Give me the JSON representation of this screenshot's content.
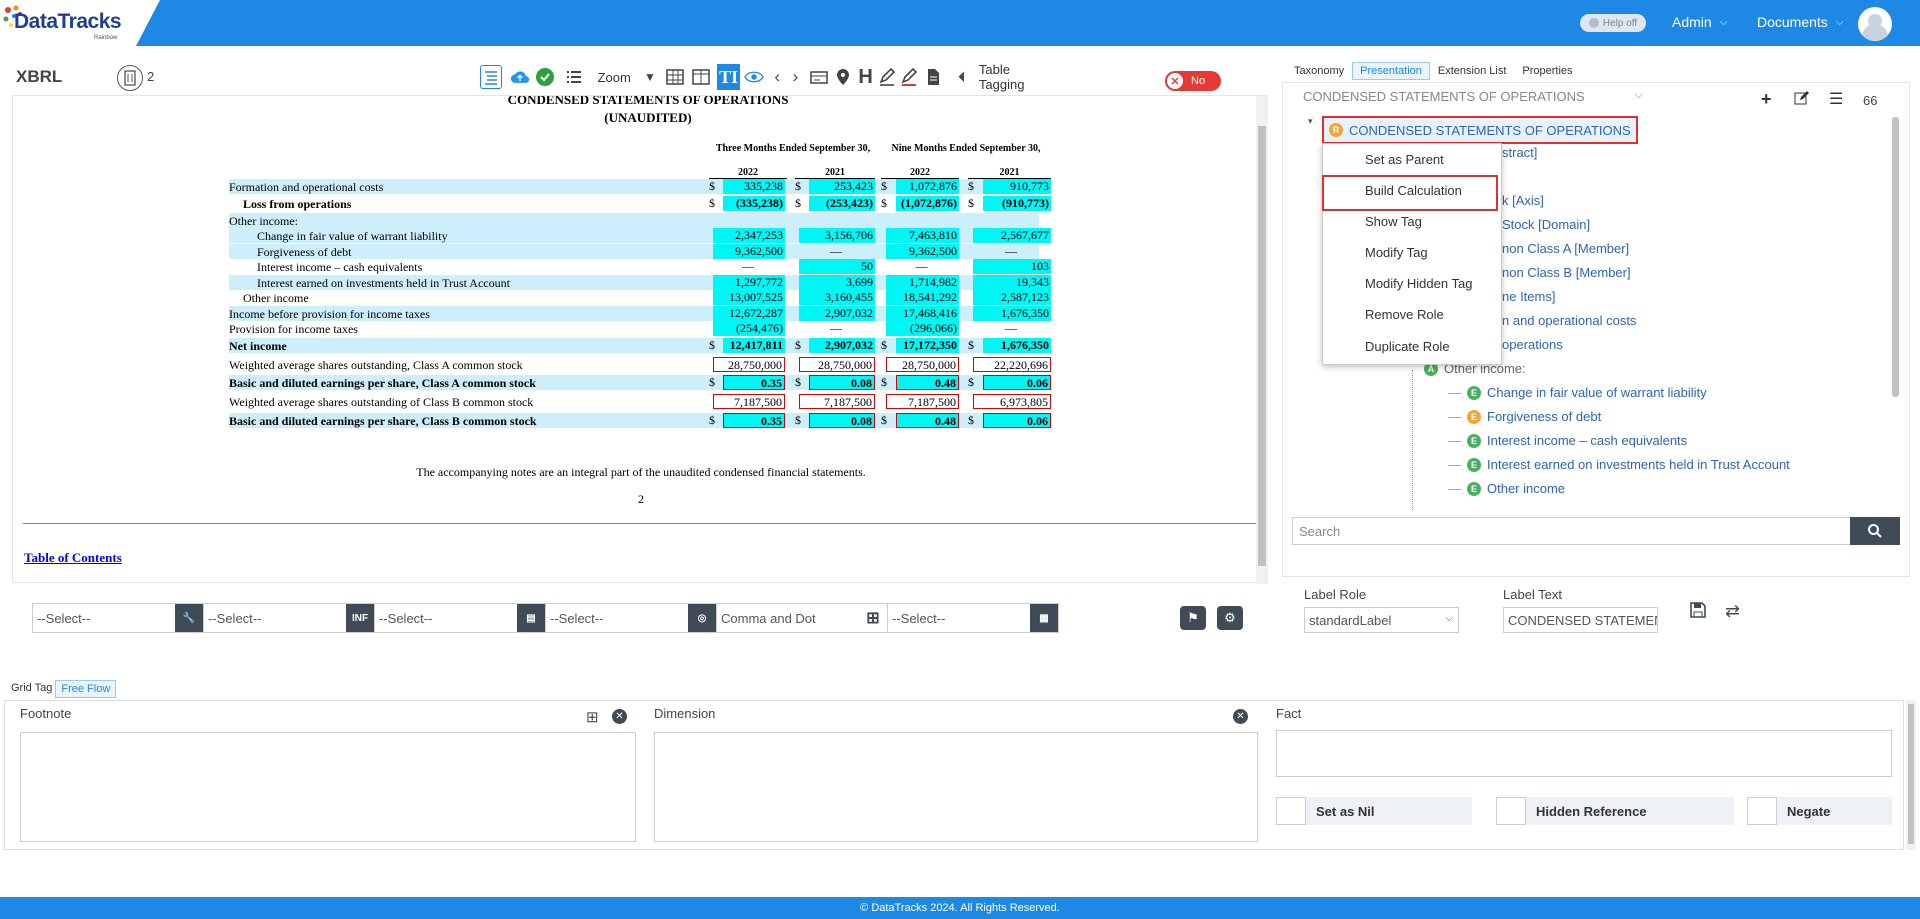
{
  "header": {
    "logo_text": "DataTracks",
    "logo_sub": "Rainbow",
    "help_toggle": "Help off",
    "admin_menu": "Admin",
    "documents_menu": "Documents"
  },
  "toolbar": {
    "app_label": "XBRL",
    "page_count": "2",
    "zoom_label": "Zoom",
    "table_tagging_label": "Table Tagging",
    "table_tagging_toggle": "No"
  },
  "document": {
    "title": "CONDENSED STATEMENTS OF OPERATIONS",
    "subtitle": "(UNAUDITED)",
    "col_groups": [
      "Three Months Ended September 30,",
      "Nine Months Ended September 30,"
    ],
    "years": [
      "2022",
      "2021",
      "2022",
      "2021"
    ],
    "rows": [
      {
        "label": "Formation and operational costs",
        "values": [
          "335,238",
          "253,423",
          "1,072,876",
          "910,773"
        ]
      },
      {
        "label": "Loss from operations",
        "values": [
          "(335,238)",
          "(253,423)",
          "(1,072,876)",
          "(910,773)"
        ]
      },
      {
        "label": "Other income:",
        "values": []
      },
      {
        "label": "Change in fair value of warrant liability",
        "values": [
          "2,347,253",
          "3,156,706",
          "7,463,810",
          "2,567,677"
        ]
      },
      {
        "label": "Forgiveness of debt",
        "values": [
          "9,362,500",
          "—",
          "9,362,500",
          "—"
        ]
      },
      {
        "label": "Interest income – cash equivalents",
        "values": [
          "—",
          "50",
          "—",
          "103"
        ]
      },
      {
        "label": "Interest earned on investments held in Trust Account",
        "values": [
          "1,297,772",
          "3,699",
          "1,714,982",
          "19,343"
        ]
      },
      {
        "label": "Other income",
        "values": [
          "13,007,525",
          "3,160,455",
          "18,541,292",
          "2,587,123"
        ]
      },
      {
        "label": "Income before provision for income taxes",
        "values": [
          "12,672,287",
          "2,907,032",
          "17,468,416",
          "1,676,350"
        ]
      },
      {
        "label": "Provision for income taxes",
        "values": [
          "(254,476)",
          "—",
          "(296,066)",
          "—"
        ]
      },
      {
        "label": "Net income",
        "values": [
          "12,417,811",
          "2,907,032",
          "17,172,350",
          "1,676,350"
        ]
      },
      {
        "label": "Weighted average shares outstanding, Class A common stock",
        "values": [
          "28,750,000",
          "28,750,000",
          "28,750,000",
          "22,220,696"
        ]
      },
      {
        "label": "Basic and diluted earnings per share, Class A common stock",
        "values": [
          "0.35",
          "0.08",
          "0.48",
          "0.06"
        ]
      },
      {
        "label": "Weighted average shares outstanding of Class B common stock",
        "values": [
          "7,187,500",
          "7,187,500",
          "7,187,500",
          "6,973,805"
        ]
      },
      {
        "label": "Basic and diluted earnings per share, Class B common stock",
        "values": [
          "0.35",
          "0.08",
          "0.48",
          "0.06"
        ]
      }
    ],
    "dollar": "$",
    "note": "The accompanying notes are an integral part of the unaudited condensed financial statements.",
    "page_no": "2",
    "toc_link": "Table of Contents"
  },
  "selectors": {
    "s1": "--Select--",
    "s2": "--Select--",
    "s3": "--Select--",
    "s4": "--Select--",
    "s5": "Comma and Dot",
    "s6": "--Select--",
    "s2_badge": "INF"
  },
  "right_panel": {
    "tabs": [
      "Taxonomy",
      "Presentation",
      "Extension List",
      "Properties"
    ],
    "role_select": "CONDENSED STATEMENTS OF OPERATIONS",
    "count": "66",
    "tree": [
      {
        "text": "CONDENSED STATEMENTS OF OPERATIONS",
        "icon": "R"
      },
      {
        "text": "stract]"
      },
      {
        "text": "k [Axis]"
      },
      {
        "text": "Stock [Domain]"
      },
      {
        "text": "non Class A [Member]"
      },
      {
        "text": "non Class B [Member]"
      },
      {
        "text": "ne Items]"
      },
      {
        "text": "n and operational costs"
      },
      {
        "text": "operations"
      },
      {
        "text": "Other income:",
        "icon": "A"
      },
      {
        "text": "Change in fair value of warrant liability",
        "icon": "E"
      },
      {
        "text": "Forgiveness of debt",
        "icon": "E"
      },
      {
        "text": "Interest income – cash equivalents",
        "icon": "E"
      },
      {
        "text": "Interest earned on investments held in Trust Account",
        "icon": "E"
      },
      {
        "text": "Other income",
        "icon": "E"
      }
    ],
    "context_menu": [
      "Set as Parent",
      "Build Calculation",
      "Show Tag",
      "Modify Tag",
      "Modify Hidden Tag",
      "Remove Role",
      "Duplicate Role"
    ],
    "search_placeholder": "Search",
    "label_role_label": "Label Role",
    "label_role_value": "standardLabel",
    "label_text_label": "Label Text",
    "label_text_value": "CONDENSED STATEMEN"
  },
  "bottom": {
    "tabs": [
      "Grid Tag",
      "Free Flow"
    ],
    "footnote": "Footnote",
    "dimension": "Dimension",
    "fact": "Fact",
    "set_as_nil": "Set as Nil",
    "hidden_reference": "Hidden Reference",
    "negate": "Negate"
  },
  "footer": "© DataTracks 2024. All Rights Reserved.",
  "colors": {
    "brand": "#1e88e5",
    "cell_highlight": "#00f5f5",
    "row_highlight": "#cdeefb",
    "tag_error": "#dd0000"
  }
}
